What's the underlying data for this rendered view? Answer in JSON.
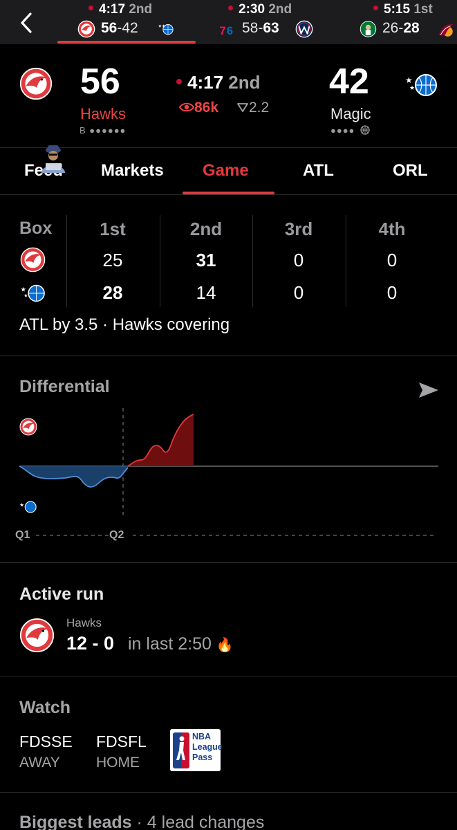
{
  "ticker": {
    "back_icon": "chevron-left-icon",
    "games": [
      {
        "clock": "4:17",
        "period": "2nd",
        "away_score": "56",
        "home_score": "42",
        "away_logo": "hawks-logo",
        "home_logo": "magic-logo",
        "selected": true
      },
      {
        "clock": "2:30",
        "period": "2nd",
        "away_score": "58",
        "home_score": "63",
        "away_logo": "76ers-logo",
        "home_logo": "wizards-logo"
      },
      {
        "clock": "5:15",
        "period": "1st",
        "away_score": "26",
        "home_score": "28",
        "away_logo": "celtics-logo",
        "home_logo": "heat-logo"
      }
    ]
  },
  "scoreboard": {
    "away": {
      "score": "56",
      "name": "Hawks",
      "sub": "B ●●●●●●"
    },
    "home": {
      "score": "42",
      "name": "Magic",
      "sub": "●●●●"
    },
    "clock": "4:17",
    "period": "2nd",
    "viewers": "86k",
    "spread": "2.2"
  },
  "tabs": [
    {
      "label": "Feed",
      "active": false
    },
    {
      "label": "Markets",
      "active": false
    },
    {
      "label": "Game",
      "active": true
    },
    {
      "label": "ATL",
      "active": false
    },
    {
      "label": "ORL",
      "active": false
    }
  ],
  "box": {
    "headers": [
      "Box",
      "1st",
      "2nd",
      "3rd",
      "4th"
    ],
    "rows": [
      {
        "team": "hawks-logo",
        "values": [
          "25",
          "31",
          "0",
          "0"
        ],
        "bold": [
          false,
          true,
          false,
          false
        ]
      },
      {
        "team": "magic-logo",
        "values": [
          "28",
          "14",
          "0",
          "0"
        ],
        "bold": [
          true,
          false,
          false,
          false
        ]
      }
    ],
    "note": "ATL by 3.5 · Hawks covering"
  },
  "differential": {
    "title": "Differential",
    "quarter_labels": [
      "Q1",
      "Q2"
    ],
    "colors": {
      "hawks": "#c8102e",
      "magic": "#1f5a9a"
    }
  },
  "active_run": {
    "title": "Active run",
    "team": "Hawks",
    "score": "12 - 0",
    "description": "in last 2:50",
    "emoji": "🔥"
  },
  "watch": {
    "title": "Watch",
    "networks": [
      {
        "name": "FDSSE",
        "role": "AWAY"
      },
      {
        "name": "FDSFL",
        "role": "HOME"
      }
    ],
    "league_pass": [
      "NBA",
      "League",
      "Pass"
    ]
  },
  "biggest_leads": {
    "title": "Biggest leads",
    "subtitle": "· 4 lead changes"
  }
}
